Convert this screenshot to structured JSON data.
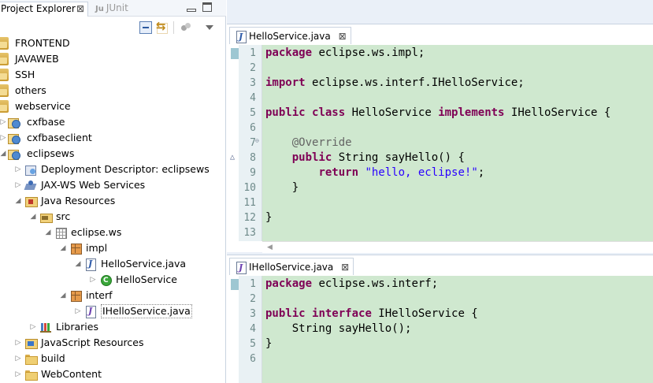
{
  "left_panel": {
    "tabs": [
      {
        "label": "Project Explorer",
        "close": "⊠"
      },
      {
        "label": "JUnit",
        "prefix": "Ju"
      }
    ],
    "tree": [
      {
        "label": "FRONTEND",
        "depth": 0,
        "arrow": "",
        "icon": "project-icon"
      },
      {
        "label": "JAVAWEB",
        "depth": 0,
        "arrow": "",
        "icon": "project-icon"
      },
      {
        "label": "SSH",
        "depth": 0,
        "arrow": "",
        "icon": "project-icon"
      },
      {
        "label": "others",
        "depth": 0,
        "arrow": "",
        "icon": "project-icon"
      },
      {
        "label": "webservice",
        "depth": 0,
        "arrow": "",
        "icon": "project-icon"
      },
      {
        "label": "cxfbase",
        "depth": 0,
        "arrow": "▷",
        "icon": "web-project-icon"
      },
      {
        "label": "cxfbaseclient",
        "depth": 0,
        "arrow": "▷",
        "icon": "web-project-icon"
      },
      {
        "label": "eclipsews",
        "depth": 0,
        "arrow": "◢",
        "icon": "web-project-icon"
      },
      {
        "label": "Deployment Descriptor: eclipsews",
        "depth": 1,
        "arrow": "▷",
        "icon": "deployment-descriptor-icon"
      },
      {
        "label": "JAX-WS Web Services",
        "depth": 1,
        "arrow": "▷",
        "icon": "jaxws-icon"
      },
      {
        "label": "Java Resources",
        "depth": 1,
        "arrow": "◢",
        "icon": "java-resources-icon"
      },
      {
        "label": "src",
        "depth": 2,
        "arrow": "◢",
        "icon": "source-folder-icon"
      },
      {
        "label": "eclipse.ws",
        "depth": 3,
        "arrow": "◢",
        "icon": "empty-package-icon"
      },
      {
        "label": "impl",
        "depth": 4,
        "arrow": "◢",
        "icon": "package-icon"
      },
      {
        "label": "HelloService.java",
        "depth": 5,
        "arrow": "◢",
        "icon": "java-file-icon"
      },
      {
        "label": "HelloService",
        "depth": 6,
        "arrow": "▷",
        "icon": "class-icon"
      },
      {
        "label": "interf",
        "depth": 4,
        "arrow": "◢",
        "icon": "package-icon"
      },
      {
        "label": "IHelloService.java",
        "depth": 5,
        "arrow": "▷",
        "icon": "interface-file-icon",
        "selected": true
      },
      {
        "label": "Libraries",
        "depth": 2,
        "arrow": "▷",
        "icon": "library-icon"
      },
      {
        "label": "JavaScript Resources",
        "depth": 1,
        "arrow": "▷",
        "icon": "javascript-resources-icon"
      },
      {
        "label": "build",
        "depth": 1,
        "arrow": "▷",
        "icon": "folder-icon"
      },
      {
        "label": "WebContent",
        "depth": 1,
        "arrow": "▷",
        "icon": "folder-icon"
      }
    ]
  },
  "editors": [
    {
      "tab": {
        "label": "HelloService.java",
        "close": "⊠"
      },
      "lines": [
        {
          "num": "1",
          "tokens": [
            {
              "t": "package",
              "c": "kw"
            },
            {
              "t": " eclipse.ws.impl;",
              "c": "txt"
            }
          ]
        },
        {
          "num": "2",
          "tokens": []
        },
        {
          "num": "3",
          "tokens": [
            {
              "t": "import",
              "c": "kw"
            },
            {
              "t": " eclipse.ws.interf.IHelloService;",
              "c": "txt"
            }
          ]
        },
        {
          "num": "4",
          "tokens": []
        },
        {
          "num": "5",
          "tokens": [
            {
              "t": "public",
              "c": "kw"
            },
            {
              "t": " ",
              "c": "txt"
            },
            {
              "t": "class",
              "c": "kw"
            },
            {
              "t": " HelloService ",
              "c": "txt"
            },
            {
              "t": "implements",
              "c": "kw"
            },
            {
              "t": " IHelloService {",
              "c": "txt"
            }
          ]
        },
        {
          "num": "6",
          "tokens": []
        },
        {
          "num": "7",
          "fold": "⊖",
          "tokens": [
            {
              "t": "    ",
              "c": "txt"
            },
            {
              "t": "@Override",
              "c": "ann"
            }
          ]
        },
        {
          "num": "8",
          "marker": "△",
          "tokens": [
            {
              "t": "    ",
              "c": "txt"
            },
            {
              "t": "public",
              "c": "kw"
            },
            {
              "t": " String sayHello() {",
              "c": "txt"
            }
          ]
        },
        {
          "num": "9",
          "tokens": [
            {
              "t": "        ",
              "c": "txt"
            },
            {
              "t": "return",
              "c": "kw"
            },
            {
              "t": " ",
              "c": "txt"
            },
            {
              "t": "\"hello, eclipse!\"",
              "c": "str"
            },
            {
              "t": ";",
              "c": "txt"
            }
          ]
        },
        {
          "num": "10",
          "tokens": [
            {
              "t": "    }",
              "c": "txt"
            }
          ]
        },
        {
          "num": "11",
          "tokens": []
        },
        {
          "num": "12",
          "tokens": [
            {
              "t": "}",
              "c": "txt"
            }
          ]
        },
        {
          "num": "13",
          "tokens": []
        }
      ]
    },
    {
      "tab": {
        "label": "IHelloService.java",
        "close": "⊠"
      },
      "lines": [
        {
          "num": "1",
          "tokens": [
            {
              "t": "package",
              "c": "kw"
            },
            {
              "t": " eclipse.ws.interf;",
              "c": "txt"
            }
          ]
        },
        {
          "num": "2",
          "tokens": []
        },
        {
          "num": "3",
          "tokens": [
            {
              "t": "public",
              "c": "kw"
            },
            {
              "t": " ",
              "c": "txt"
            },
            {
              "t": "interface",
              "c": "kw"
            },
            {
              "t": " IHelloService {",
              "c": "txt"
            }
          ]
        },
        {
          "num": "4",
          "tokens": [
            {
              "t": "    String sayHello();",
              "c": "txt"
            }
          ]
        },
        {
          "num": "5",
          "tokens": [
            {
              "t": "}",
              "c": "txt"
            }
          ]
        },
        {
          "num": "6",
          "tokens": []
        }
      ]
    }
  ],
  "colors": {
    "keyword": "#7f0055",
    "string": "#2a00ff",
    "annotation": "#646464",
    "editor_background": "#cfe8cf"
  }
}
